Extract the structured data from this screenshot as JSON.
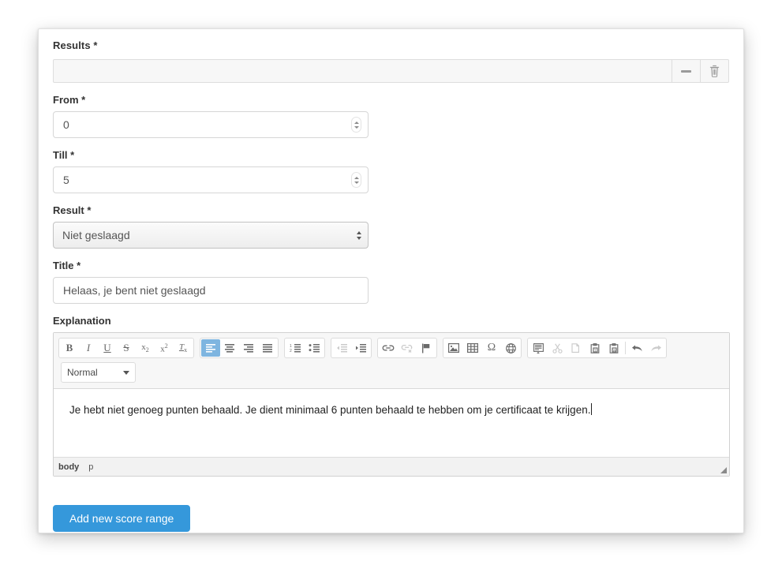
{
  "panel": {
    "section_title": "Results *",
    "collapse_button_label": "",
    "delete_button_label": ""
  },
  "fields": {
    "from": {
      "label": "From *",
      "value": "0"
    },
    "till": {
      "label": "Till *",
      "value": "5"
    },
    "result": {
      "label": "Result *",
      "selected": "Niet geslaagd"
    },
    "title": {
      "label": "Title *",
      "value": "Helaas, je bent niet geslaagd"
    },
    "explanation": {
      "label": "Explanation"
    }
  },
  "editor": {
    "format_selected": "Normal",
    "content": "Je hebt niet genoeg punten behaald. Je dient minimaal 6 punten behaald te hebben om je certificaat te krijgen.",
    "status_path": [
      "body",
      "p"
    ],
    "toolbar": {
      "groups": [
        {
          "name": "basic-styles",
          "buttons": [
            {
              "name": "bold",
              "glyph": "B",
              "state": "normal"
            },
            {
              "name": "italic",
              "glyph": "I",
              "state": "normal"
            },
            {
              "name": "underline",
              "glyph": "U",
              "state": "normal"
            },
            {
              "name": "strikethrough",
              "glyph": "S",
              "state": "normal"
            },
            {
              "name": "subscript",
              "glyph": "x₂",
              "state": "normal"
            },
            {
              "name": "superscript",
              "glyph": "x²",
              "state": "normal"
            },
            {
              "name": "remove-format",
              "glyph": "Tx",
              "state": "normal"
            }
          ]
        },
        {
          "name": "alignment",
          "buttons": [
            {
              "name": "align-left",
              "glyph": "align-left-icon",
              "state": "active"
            },
            {
              "name": "align-center",
              "glyph": "align-center-icon",
              "state": "normal"
            },
            {
              "name": "align-right",
              "glyph": "align-right-icon",
              "state": "normal"
            },
            {
              "name": "align-justify",
              "glyph": "align-justify-icon",
              "state": "normal"
            }
          ]
        },
        {
          "name": "lists",
          "buttons": [
            {
              "name": "numbered-list",
              "glyph": "numbered-list-icon",
              "state": "normal"
            },
            {
              "name": "bulleted-list",
              "glyph": "bulleted-list-icon",
              "state": "normal"
            }
          ]
        },
        {
          "name": "indent",
          "buttons": [
            {
              "name": "outdent",
              "glyph": "outdent-icon",
              "state": "disabled"
            },
            {
              "name": "indent",
              "glyph": "indent-icon",
              "state": "normal"
            }
          ]
        },
        {
          "name": "links",
          "buttons": [
            {
              "name": "link",
              "glyph": "link-icon",
              "state": "normal"
            },
            {
              "name": "unlink",
              "glyph": "unlink-icon",
              "state": "disabled"
            },
            {
              "name": "anchor",
              "glyph": "flag-icon",
              "state": "normal"
            }
          ]
        },
        {
          "name": "insert",
          "buttons": [
            {
              "name": "image",
              "glyph": "image-icon",
              "state": "normal"
            },
            {
              "name": "table",
              "glyph": "table-icon",
              "state": "normal"
            },
            {
              "name": "special-character",
              "glyph": "omega-icon",
              "state": "normal"
            },
            {
              "name": "iframe",
              "glyph": "globe-icon",
              "state": "normal"
            }
          ]
        },
        {
          "name": "clipboard",
          "buttons": [
            {
              "name": "templates",
              "glyph": "templates-icon",
              "state": "normal"
            },
            {
              "name": "cut",
              "glyph": "scissors-icon",
              "state": "disabled"
            },
            {
              "name": "copy",
              "glyph": "copy-icon",
              "state": "disabled"
            },
            {
              "name": "paste-text",
              "glyph": "paste-text-icon",
              "state": "normal"
            },
            {
              "name": "paste-word",
              "glyph": "paste-word-icon",
              "state": "normal"
            },
            {
              "name": "undo",
              "glyph": "undo-icon",
              "state": "normal"
            },
            {
              "name": "redo",
              "glyph": "redo-icon",
              "state": "disabled"
            }
          ]
        }
      ]
    }
  },
  "actions": {
    "add_score_range": "Add new score range"
  },
  "colors": {
    "primary": "#3598db",
    "toolbar_active": "#7eb5e0",
    "panel_bg": "#ffffff",
    "strip_bg": "#f7f7f7",
    "status_bg": "#f2f2f2"
  }
}
